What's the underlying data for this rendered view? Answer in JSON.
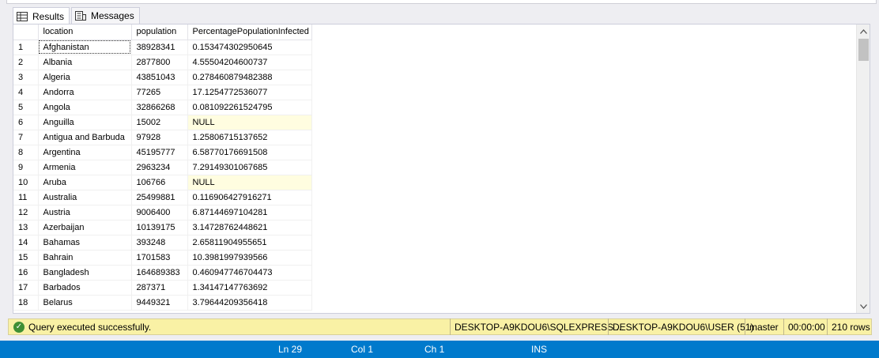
{
  "tabs": [
    {
      "label": "Results",
      "icon": "grid-icon",
      "active": true
    },
    {
      "label": "Messages",
      "icon": "messages-icon",
      "active": false
    }
  ],
  "grid": {
    "columns": [
      "location",
      "population",
      "PercentagePopulationInfected"
    ],
    "rows": [
      {
        "n": "1",
        "location": "Afghanistan",
        "population": "38928341",
        "pct": "0.153474302950645"
      },
      {
        "n": "2",
        "location": "Albania",
        "population": "2877800",
        "pct": "4.55504204600737"
      },
      {
        "n": "3",
        "location": "Algeria",
        "population": "43851043",
        "pct": "0.278460879482388"
      },
      {
        "n": "4",
        "location": "Andorra",
        "population": "77265",
        "pct": "17.1254772536077"
      },
      {
        "n": "5",
        "location": "Angola",
        "population": "32866268",
        "pct": "0.081092261524795"
      },
      {
        "n": "6",
        "location": "Anguilla",
        "population": "15002",
        "pct": "NULL"
      },
      {
        "n": "7",
        "location": "Antigua and Barbuda",
        "population": "97928",
        "pct": "1.25806715137652"
      },
      {
        "n": "8",
        "location": "Argentina",
        "population": "45195777",
        "pct": "6.58770176691508"
      },
      {
        "n": "9",
        "location": "Armenia",
        "population": "2963234",
        "pct": "7.29149301067685"
      },
      {
        "n": "10",
        "location": "Aruba",
        "population": "106766",
        "pct": "NULL"
      },
      {
        "n": "11",
        "location": "Australia",
        "population": "25499881",
        "pct": "0.116906427916271"
      },
      {
        "n": "12",
        "location": "Austria",
        "population": "9006400",
        "pct": "6.87144697104281"
      },
      {
        "n": "13",
        "location": "Azerbaijan",
        "population": "10139175",
        "pct": "3.14728762448621"
      },
      {
        "n": "14",
        "location": "Bahamas",
        "population": "393248",
        "pct": "2.65811904955651"
      },
      {
        "n": "15",
        "location": "Bahrain",
        "population": "1701583",
        "pct": "10.3981997939566"
      },
      {
        "n": "16",
        "location": "Bangladesh",
        "population": "164689383",
        "pct": "0.460947746704473"
      },
      {
        "n": "17",
        "location": "Barbados",
        "population": "287371",
        "pct": "1.34147147763692"
      },
      {
        "n": "18",
        "location": "Belarus",
        "population": "9449321",
        "pct": "3.79644209356418"
      }
    ]
  },
  "status": {
    "message": "Query executed successfully.",
    "server": "DESKTOP-A9KDOU6\\SQLEXPRESS ...",
    "user": "DESKTOP-A9KDOU6\\USER (51)",
    "database": "master",
    "elapsed": "00:00:00",
    "rows": "210 rows",
    "color": "#f9f1a5"
  },
  "editor_status": {
    "ln": "Ln 29",
    "col": "Col 1",
    "ch": "Ch 1",
    "mode": "INS",
    "color": "#007acc"
  }
}
